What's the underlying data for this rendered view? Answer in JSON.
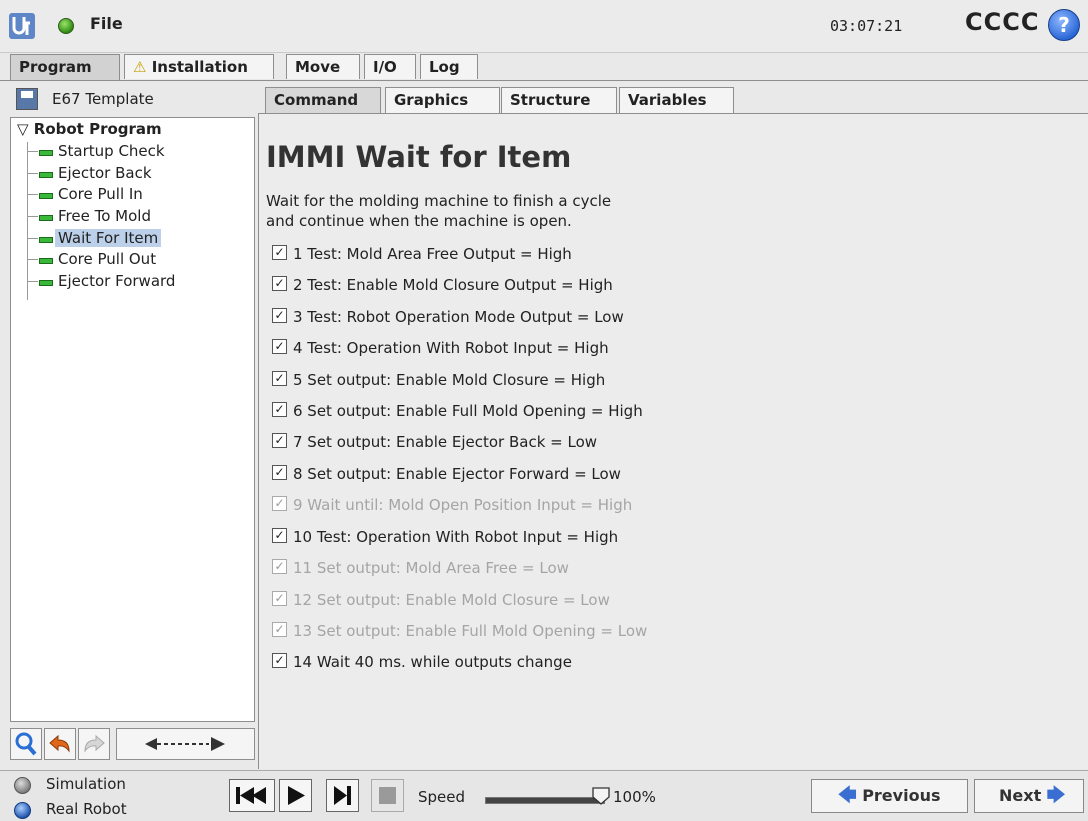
{
  "topbar": {
    "file_label": "File",
    "clock": "03:07:21",
    "robot_name": "CCCC",
    "help_label": "?"
  },
  "main_tabs": [
    {
      "label": "Program",
      "active": true
    },
    {
      "label": "Installation",
      "warning": true
    },
    {
      "label": "Move"
    },
    {
      "label": "I/O"
    },
    {
      "label": "Log"
    }
  ],
  "program": {
    "name": "E67 Template",
    "tree": {
      "root": "Robot Program",
      "items": [
        {
          "label": "Startup Check"
        },
        {
          "label": "Ejector Back"
        },
        {
          "label": "Core Pull In"
        },
        {
          "label": "Free To Mold"
        },
        {
          "label": "Wait For Item",
          "selected": true
        },
        {
          "label": "Core Pull Out"
        },
        {
          "label": "Ejector Forward"
        }
      ]
    }
  },
  "sub_tabs": [
    {
      "label": "Command",
      "active": true
    },
    {
      "label": "Graphics"
    },
    {
      "label": "Structure"
    },
    {
      "label": "Variables"
    }
  ],
  "command": {
    "title": "IMMI Wait for Item",
    "description_line1": "Wait for the molding machine to finish a cycle",
    "description_line2": "and continue when the machine is open.",
    "checks": [
      {
        "label": "1 Test: Mold Area Free Output = High",
        "enabled": true
      },
      {
        "label": "2 Test: Enable Mold Closure Output = High",
        "enabled": true
      },
      {
        "label": "3 Test: Robot Operation Mode Output = Low",
        "enabled": true
      },
      {
        "label": "4 Test: Operation With Robot Input = High",
        "enabled": true
      },
      {
        "label": "5 Set output: Enable Mold Closure = High",
        "enabled": true
      },
      {
        "label": "6 Set output: Enable Full Mold Opening = High",
        "enabled": true
      },
      {
        "label": "7 Set output: Enable Ejector Back = Low",
        "enabled": true
      },
      {
        "label": "8 Set output: Enable Ejector Forward = Low",
        "enabled": true
      },
      {
        "label": "9 Wait until: Mold Open Position Input = High",
        "enabled": false
      },
      {
        "label": "10 Test: Operation With Robot Input = High",
        "enabled": true
      },
      {
        "label": "11 Set output: Mold Area Free = Low",
        "enabled": false
      },
      {
        "label": "12 Set output: Enable Mold Closure = Low",
        "enabled": false
      },
      {
        "label": "13 Set output: Enable Full Mold Opening = Low",
        "enabled": false
      },
      {
        "label": "14 Wait 40 ms. while outputs change",
        "enabled": true
      }
    ]
  },
  "bottombar": {
    "mode_simulation": "Simulation",
    "mode_real": "Real Robot",
    "speed_label": "Speed",
    "speed_value": "100%",
    "speed_fraction": 1.0,
    "previous_label": "Previous",
    "next_label": "Next"
  },
  "colors": {
    "selection": "#bcd0ea",
    "status_green": "#3ab83a",
    "accent_blue": "#3a6fd1"
  }
}
